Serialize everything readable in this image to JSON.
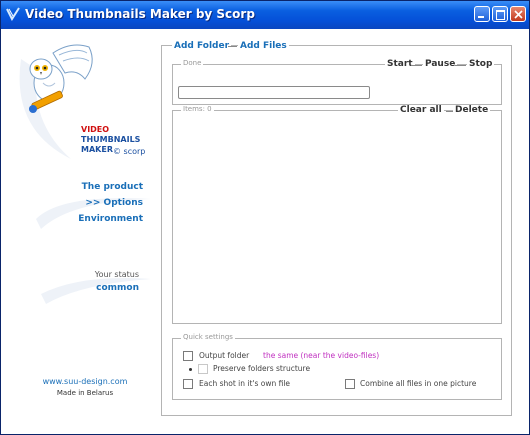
{
  "window": {
    "title": "Video Thumbnails Maker by Scorp"
  },
  "sidebar": {
    "logo": {
      "line1": "VIDEO",
      "line2": "THUMBNAILS",
      "line3": "MAKER",
      "by": "© scorp"
    },
    "nav": [
      {
        "label": "The product"
      },
      {
        "label": ">> Options"
      },
      {
        "label": "Environment"
      }
    ],
    "status_label": "Your status",
    "status_value": "common",
    "website": "www.suu-design.com",
    "made_in": "Made in Belarus"
  },
  "main": {
    "add_folder": "Add Folder",
    "add_files": "Add Files",
    "progress_group": {
      "label": "Done",
      "start": "Start",
      "pause": "Pause",
      "stop": "Stop",
      "progress": 0
    },
    "items_group": {
      "label": "Items: 0",
      "clear_all": "Clear all",
      "delete": "Delete"
    },
    "quick_settings": {
      "label": "Quick settings",
      "output_folder_label": "Output  folder",
      "output_folder_value": "the same (near the video-files)",
      "preserve_folders_label": "Preserve folders structure",
      "each_shot_label": "Each shot in it's own file",
      "combine_label": "Combine all files in one picture"
    }
  },
  "colors": {
    "title_bar": "#0550d8",
    "link": "#1a6fb8",
    "accent_value": "#c030c0",
    "logo_red": "#d01010"
  }
}
